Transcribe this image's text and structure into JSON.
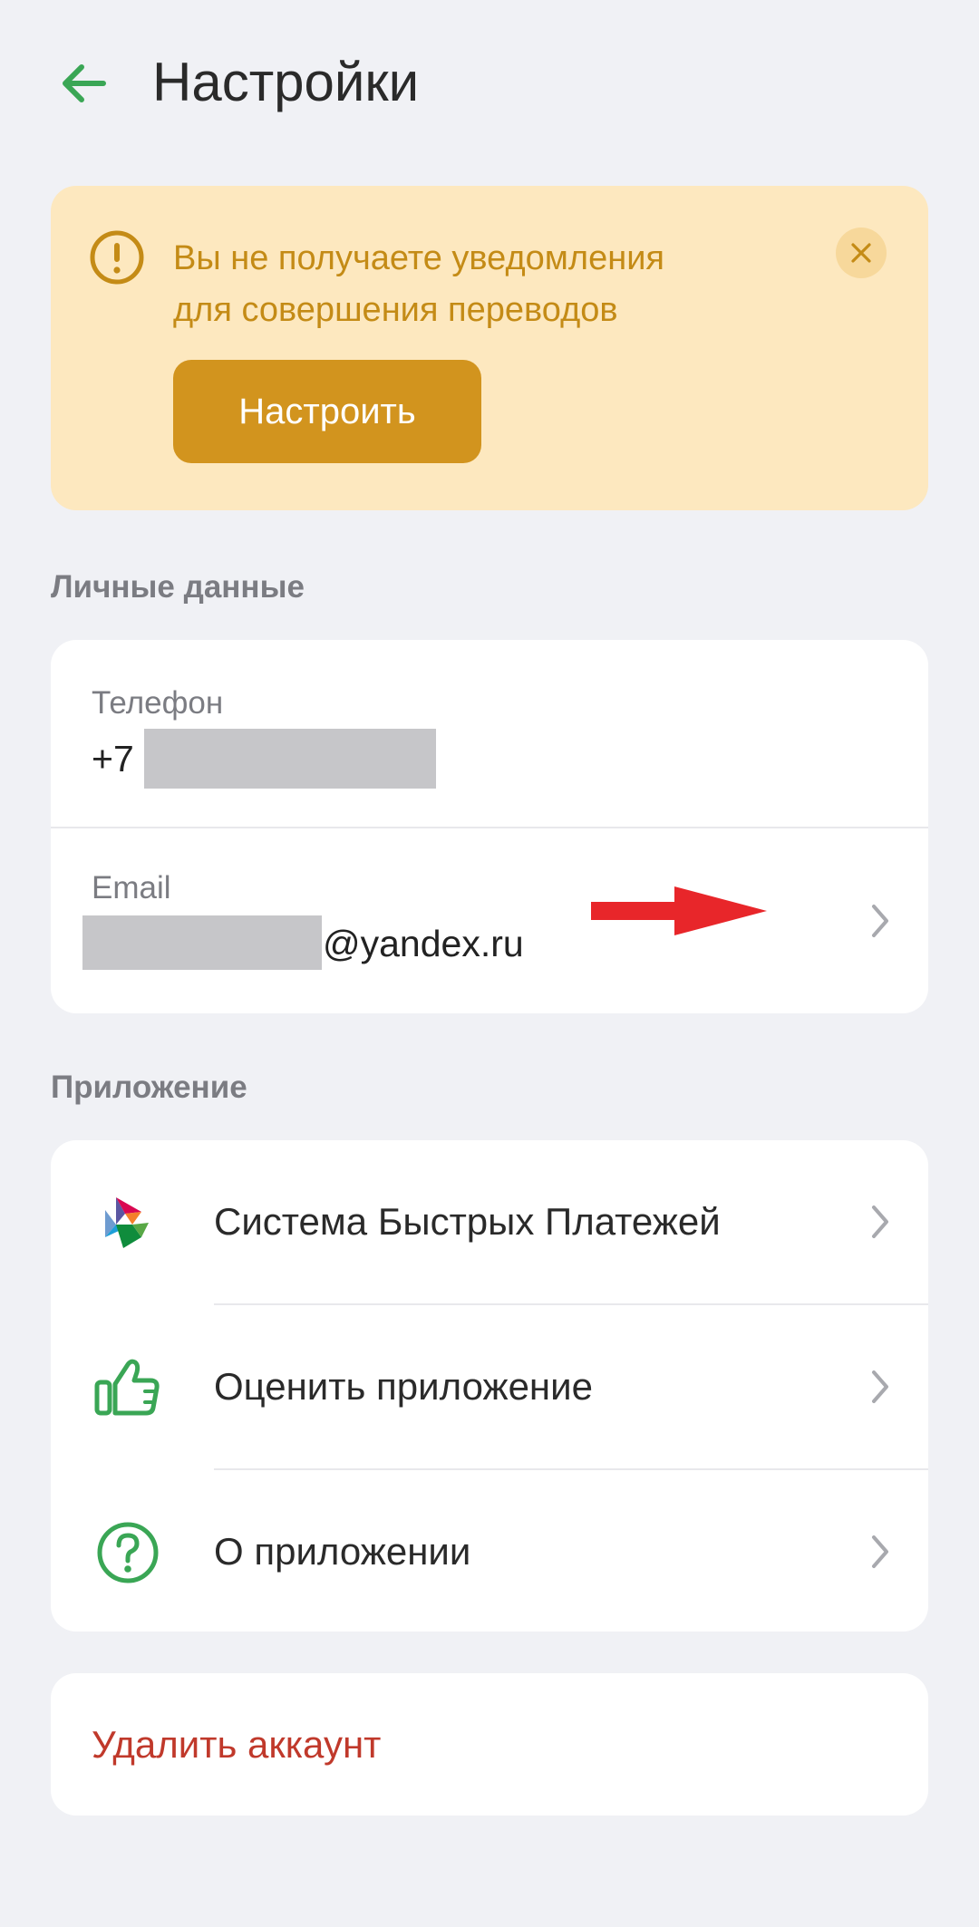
{
  "header": {
    "title": "Настройки",
    "back_icon": "arrow-left-icon"
  },
  "banner": {
    "icon": "exclamation-circle-icon",
    "text_line1": "Вы не получаете уведомления",
    "text_line2": "для совершения переводов",
    "button_label": "Настроить",
    "close_icon": "close-icon"
  },
  "personal": {
    "section_title": "Личные данные",
    "phone": {
      "label": "Телефон",
      "value_prefix": "+7"
    },
    "email": {
      "label": "Email",
      "value_suffix": "@yandex.ru"
    }
  },
  "app": {
    "section_title": "Приложение",
    "items": [
      {
        "label": "Система Быстрых Платежей",
        "icon": "sbp-logo-icon"
      },
      {
        "label": "Оценить приложение",
        "icon": "thumbs-up-icon"
      },
      {
        "label": "О приложении",
        "icon": "question-circle-icon"
      }
    ]
  },
  "account": {
    "delete_label": "Удалить аккаунт"
  },
  "colors": {
    "accent_green": "#3aa655",
    "banner_bg": "#fde8bf",
    "banner_text": "#c48b16",
    "banner_button": "#d2941e",
    "danger": "#c0392b",
    "annotation_arrow": "#e8262a"
  }
}
